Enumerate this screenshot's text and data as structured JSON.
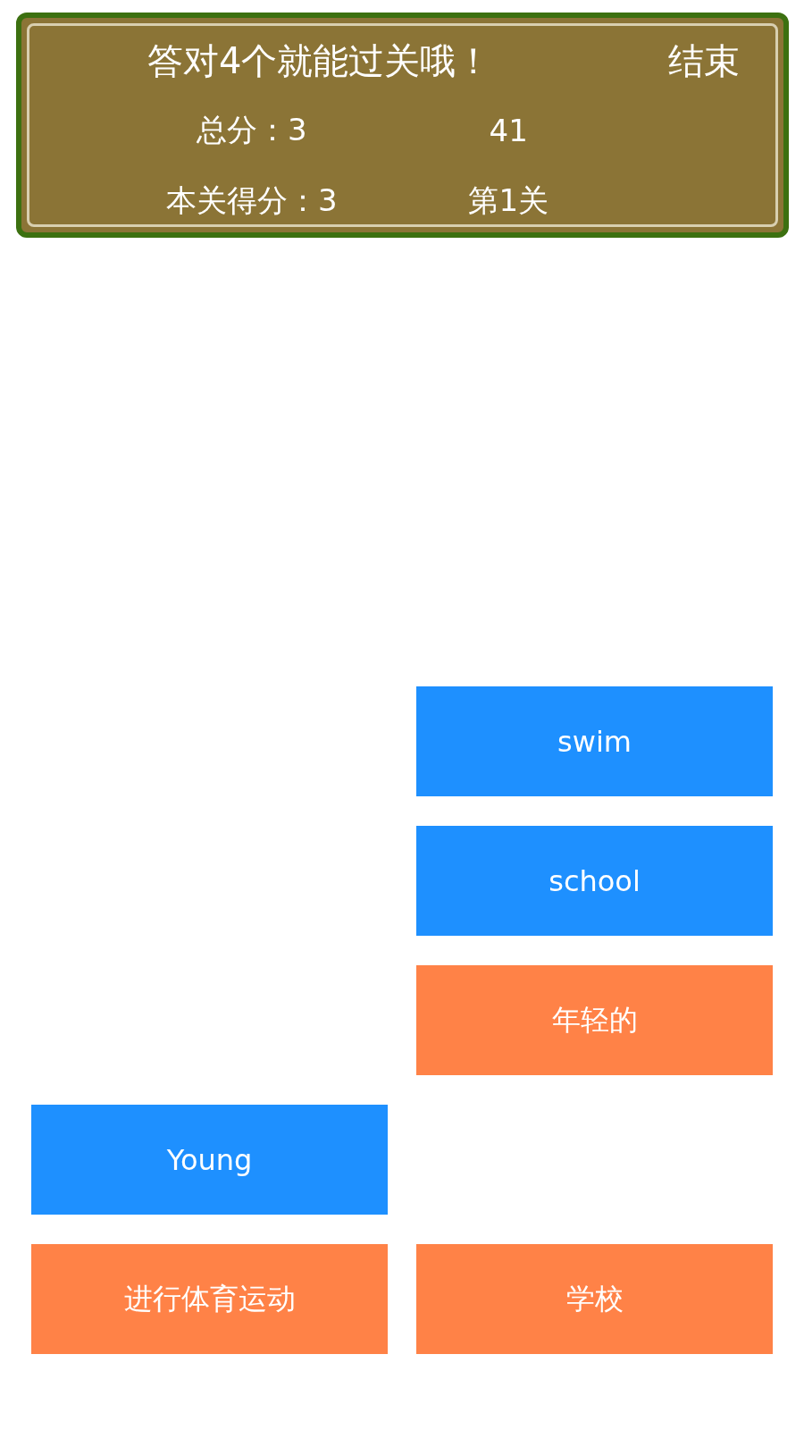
{
  "header": {
    "hint": "答对4个就能过关哦！",
    "end_button": "结束",
    "total_score": "总分：3",
    "timer": "41",
    "level_score": "本关得分：3",
    "level": "第1关"
  },
  "board": {
    "rows": [
      [
        null,
        {
          "label": "swim",
          "color": "#1e90ff"
        }
      ],
      [
        null,
        {
          "label": "school",
          "color": "#1e90ff"
        }
      ],
      [
        null,
        {
          "label": "年轻的",
          "color": "#ff8247"
        }
      ],
      [
        {
          "label": "Young",
          "color": "#1e90ff"
        },
        null
      ],
      [
        {
          "label": "进行体育运动",
          "color": "#ff8247"
        },
        {
          "label": "学校",
          "color": "#ff8247"
        }
      ]
    ]
  }
}
